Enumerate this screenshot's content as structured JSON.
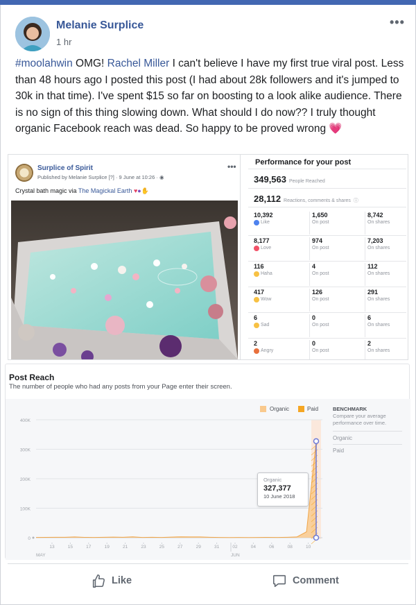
{
  "post": {
    "author": "Melanie Surplice",
    "time": "1 hr",
    "text_parts": {
      "hashtag": "#moolahwin",
      "t1": " OMG! ",
      "mention": "Rachel Miller",
      "t2": " I can't believe I have my first true viral post. Less than 48 hours ago I posted this post (I had about 28k followers and it's jumped to 30k in that time). I've spent $15 so far on boosting to a look alike audience. There is no sign of this thing slowing down. What should I do now?? I truly thought organic Facebook reach was dead. So happy to be proved wrong "
    }
  },
  "shared_post": {
    "page_name": "Surplice of Spirit",
    "meta": "Published by Melanie Surplice [?] · 9 June at 10:26 · ",
    "caption_text": "Crystal bath magic via ",
    "caption_link": "The Magickal Earth"
  },
  "performance": {
    "title": "Performance for your post",
    "people_reached": "349,563",
    "people_reached_label": "People Reached",
    "engagements": "28,112",
    "engagements_label": "Reactions, comments & shares",
    "on_post_label": "On post",
    "on_shares_label": "On shares",
    "reactions": [
      {
        "name": "Like",
        "total": "10,392",
        "on_post": "1,650",
        "on_shares": "8,742",
        "color": "#4e82ee"
      },
      {
        "name": "Love",
        "total": "8,177",
        "on_post": "974",
        "on_shares": "7,203",
        "color": "#f25268"
      },
      {
        "name": "Haha",
        "total": "116",
        "on_post": "4",
        "on_shares": "112",
        "color": "#f7c144"
      },
      {
        "name": "Wow",
        "total": "417",
        "on_post": "126",
        "on_shares": "291",
        "color": "#f7c144"
      },
      {
        "name": "Sad",
        "total": "6",
        "on_post": "0",
        "on_shares": "6",
        "color": "#f7c144"
      },
      {
        "name": "Angry",
        "total": "2",
        "on_post": "0",
        "on_shares": "2",
        "color": "#e8703c"
      }
    ]
  },
  "reach": {
    "title": "Post Reach",
    "subtitle": "The number of people who had any posts from your Page enter their screen.",
    "legend": [
      {
        "name": "Organic",
        "color": "#f9c98d"
      },
      {
        "name": "Paid",
        "color": "#f5a623"
      }
    ],
    "benchmark": {
      "title": "BENCHMARK",
      "subtitle": "Compare your average performance over time.",
      "items": [
        "Organic",
        "Paid"
      ]
    },
    "tooltip": {
      "label": "Organic",
      "value": "327,377",
      "date": "10 June 2018"
    }
  },
  "chart_data": {
    "type": "area",
    "title": "Post Reach",
    "y_ticks": [
      "0",
      "100K",
      "200K",
      "300K",
      "400K"
    ],
    "ylim": [
      0,
      400000
    ],
    "x_ticks": [
      "13",
      "15",
      "17",
      "19",
      "21",
      "23",
      "25",
      "27",
      "29",
      "31",
      "02",
      "04",
      "06",
      "08",
      "10"
    ],
    "x_month_labels": {
      "MAY": 0,
      "JUN": 10
    },
    "grid": true,
    "legend": "top-right",
    "series": [
      {
        "name": "Organic",
        "values": [
          1000,
          1200,
          1500,
          1500,
          2500,
          1200,
          1000,
          1500,
          2000,
          1500,
          3000,
          1000,
          1500,
          1000,
          2000,
          3000,
          2500,
          2500,
          1500,
          1000,
          800,
          1000,
          800,
          900,
          1200,
          1000,
          1500,
          2500,
          20000,
          327377
        ]
      },
      {
        "name": "Paid",
        "values": [
          0,
          0,
          0,
          0,
          0,
          0,
          0,
          0,
          0,
          0,
          0,
          0,
          0,
          0,
          0,
          0,
          0,
          0,
          0,
          0,
          0,
          0,
          0,
          0,
          0,
          0,
          0,
          0,
          0,
          5000
        ]
      }
    ]
  },
  "actions": {
    "like": "Like",
    "comment": "Comment"
  }
}
